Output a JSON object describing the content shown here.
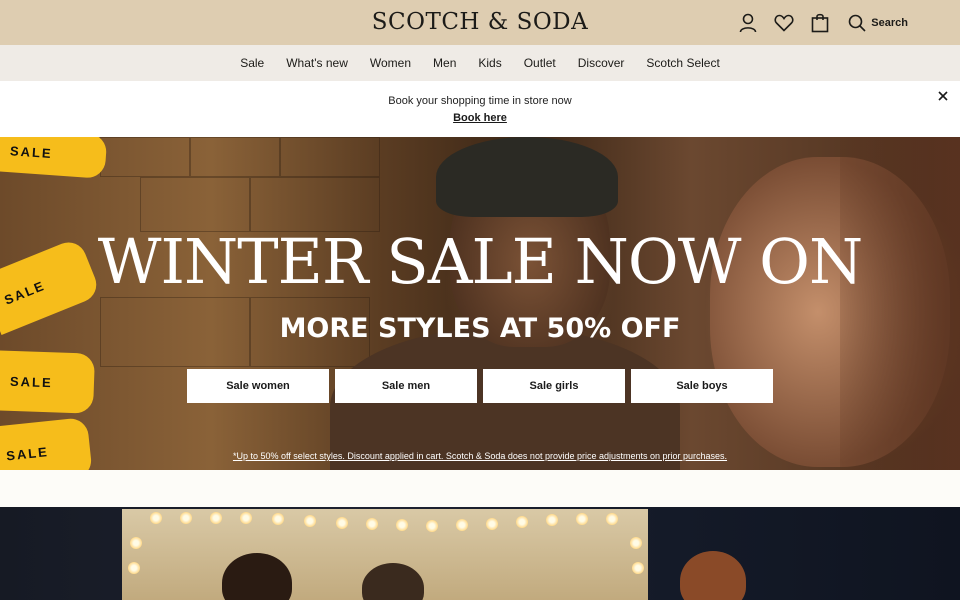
{
  "header": {
    "logo": "SCOTCH & SODA",
    "icons": [
      "account-icon",
      "wishlist-heart-icon",
      "shopping-bag-icon",
      "search-icon"
    ],
    "search_label": "Search",
    "bg_color": "#decdb1"
  },
  "nav": {
    "items": [
      "Sale",
      "What's new",
      "Women",
      "Men",
      "Kids",
      "Outlet",
      "Discover",
      "Scotch Select"
    ]
  },
  "promo": {
    "text": "Book your shopping time in store now",
    "link": "Book here"
  },
  "hero": {
    "title": "WINTER SALE NOW ON",
    "subtitle": "MORE STYLES AT 50% OFF",
    "buttons": [
      "Sale women",
      "Sale men",
      "Sale girls",
      "Sale boys"
    ],
    "tags": [
      "SALE",
      "SALE",
      "SALE",
      "SALE"
    ],
    "note": "*Up to 50% off select styles. Discount applied in cart. Scotch & Soda does not provide price adjustments on prior purchases.",
    "tag_color": "#f6bd1b"
  }
}
